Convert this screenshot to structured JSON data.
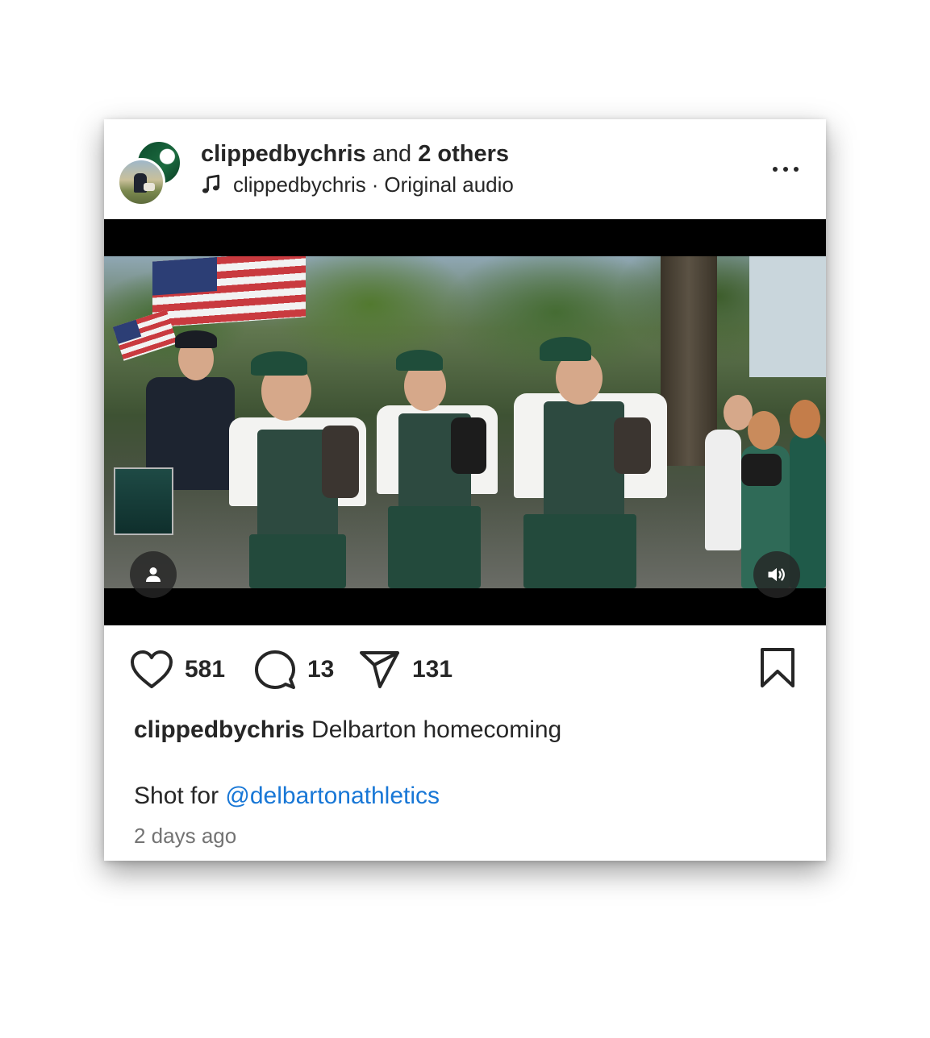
{
  "post": {
    "author": "clippedbychris",
    "collab_connector": "and",
    "collab_others": "2 others",
    "audio_author": "clippedbychris",
    "audio_separator": "·",
    "audio_label": "Original audio",
    "more_icon": "more-horizontal-icon"
  },
  "media": {
    "type": "video",
    "user_tag_icon": "person-icon",
    "sound_icon": "speaker-volume-icon"
  },
  "actions": {
    "likes": "581",
    "comments": "13",
    "shares": "131",
    "like_icon": "heart-icon",
    "comment_icon": "comment-bubble-icon",
    "share_icon": "paper-plane-icon",
    "save_icon": "bookmark-icon"
  },
  "caption": {
    "username": "clippedbychris",
    "text": "Delbarton homecoming",
    "line2_prefix": "Shot for",
    "mention": "@delbartonathletics"
  },
  "timestamp": "2 days ago",
  "colors": {
    "text": "#262626",
    "link": "#1877d6",
    "muted": "#737373",
    "video_bar": "#000000"
  }
}
